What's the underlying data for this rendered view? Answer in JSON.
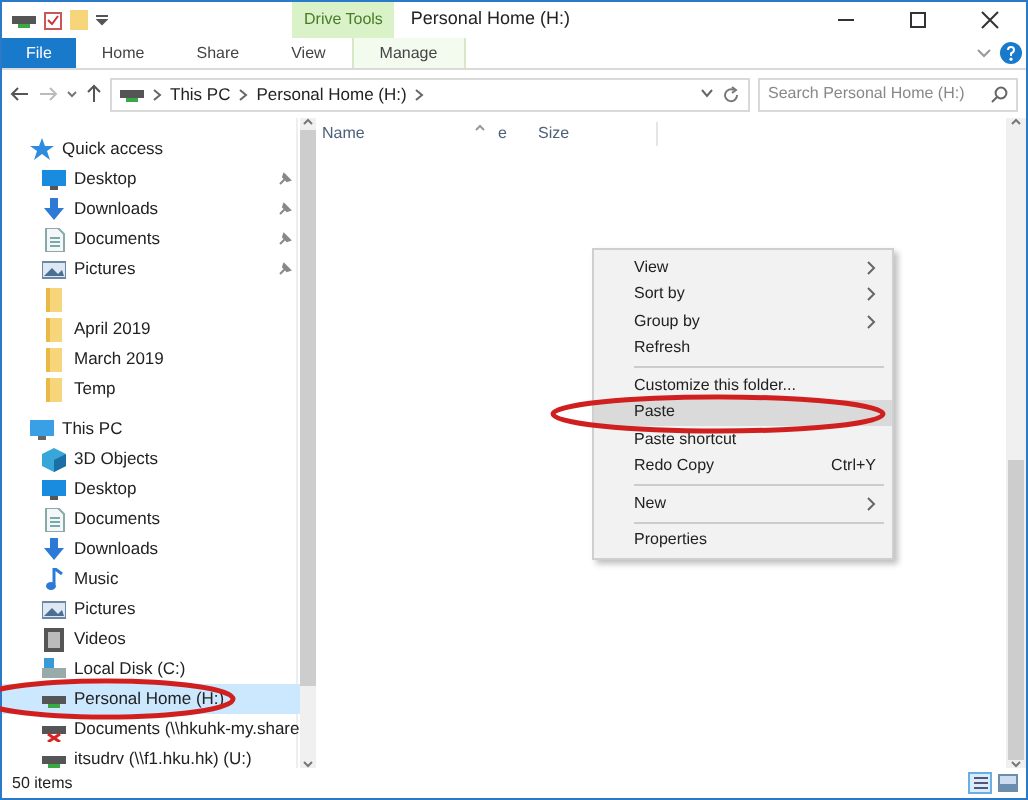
{
  "window": {
    "title": "Personal Home (H:)"
  },
  "ribbon": {
    "context_group": "Drive Tools",
    "tabs": [
      {
        "label": "File",
        "kind": "file",
        "selected": false
      },
      {
        "label": "Home",
        "kind": "tab",
        "selected": false
      },
      {
        "label": "Share",
        "kind": "tab",
        "selected": false
      },
      {
        "label": "View",
        "kind": "tab",
        "selected": false
      },
      {
        "label": "Manage",
        "kind": "context",
        "selected": false
      }
    ]
  },
  "address": {
    "path": [
      "This PC",
      "Personal Home (H:)"
    ],
    "search_placeholder": "Search Personal Home (H:)"
  },
  "sidebar": {
    "items": [
      {
        "label": "Quick access",
        "kind": "star",
        "selected": false,
        "circled": false,
        "children": [
          {
            "label": "Desktop",
            "kind": "desktop",
            "pinned": true,
            "selected": false,
            "circled": false
          },
          {
            "label": "Downloads",
            "kind": "download",
            "pinned": true,
            "selected": false,
            "circled": false
          },
          {
            "label": "Documents",
            "kind": "document",
            "pinned": true,
            "selected": false,
            "circled": false
          },
          {
            "label": "Pictures",
            "kind": "picture",
            "pinned": true,
            "selected": false,
            "circled": false
          },
          {
            "kind": "folder",
            "pinned": false,
            "selected": false,
            "circled": false
          },
          {
            "label": "April 2019",
            "kind": "folder",
            "pinned": false,
            "selected": false,
            "circled": false
          },
          {
            "label": "March 2019",
            "kind": "folder",
            "pinned": false,
            "selected": false,
            "circled": false
          },
          {
            "label": "Temp",
            "kind": "folder",
            "pinned": false,
            "selected": false,
            "circled": false
          }
        ]
      },
      {
        "label": "This PC",
        "kind": "pc",
        "selected": false,
        "circled": false,
        "children": [
          {
            "label": "3D Objects",
            "kind": "cube",
            "selected": false,
            "circled": false
          },
          {
            "label": "Desktop",
            "kind": "desktop",
            "selected": false,
            "circled": false
          },
          {
            "label": "Documents",
            "kind": "document",
            "selected": false,
            "circled": false
          },
          {
            "label": "Downloads",
            "kind": "download",
            "selected": false,
            "circled": false
          },
          {
            "label": "Music",
            "kind": "music",
            "selected": false,
            "circled": false
          },
          {
            "label": "Pictures",
            "kind": "picture",
            "selected": false,
            "circled": false
          },
          {
            "label": "Videos",
            "kind": "video",
            "selected": false,
            "circled": false
          },
          {
            "label": "Local Disk (C:)",
            "kind": "disk",
            "selected": false,
            "circled": false
          },
          {
            "label": "Personal Home (H:)",
            "kind": "drive",
            "selected": true,
            "circled": true
          },
          {
            "label": "Documents (\\\\hkuhk-my.share",
            "kind": "netdrive",
            "selected": false,
            "circled": false
          },
          {
            "label": "itsudrv (\\\\f1.hku.hk) (U:)",
            "kind": "drive",
            "selected": false,
            "circled": false
          }
        ]
      }
    ]
  },
  "columns": [
    "Name",
    "e",
    "Size"
  ],
  "context_menu": [
    {
      "kind": "item",
      "label": "View",
      "submenu": true,
      "selected": false,
      "circled": false
    },
    {
      "kind": "item",
      "label": "Sort by",
      "submenu": true,
      "selected": false,
      "circled": false
    },
    {
      "kind": "item",
      "label": "Group by",
      "submenu": true,
      "selected": false,
      "circled": false
    },
    {
      "kind": "item",
      "label": "Refresh",
      "submenu": false,
      "selected": false,
      "circled": false
    },
    {
      "kind": "separator"
    },
    {
      "kind": "item",
      "label": "Customize this folder...",
      "submenu": false,
      "selected": false,
      "circled": false
    },
    {
      "kind": "item",
      "label": "Paste",
      "submenu": false,
      "selected": true,
      "circled": true
    },
    {
      "kind": "item",
      "label": "Paste shortcut",
      "submenu": false,
      "selected": false,
      "circled": false
    },
    {
      "kind": "item",
      "label": "Redo Copy",
      "shortcut": "Ctrl+Y",
      "submenu": false,
      "selected": false,
      "circled": false
    },
    {
      "kind": "separator"
    },
    {
      "kind": "item",
      "label": "New",
      "submenu": true,
      "selected": false,
      "circled": false
    },
    {
      "kind": "separator"
    },
    {
      "kind": "item",
      "label": "Properties",
      "submenu": false,
      "selected": false,
      "circled": false
    }
  ],
  "status_bar": {
    "count": "50 items"
  }
}
